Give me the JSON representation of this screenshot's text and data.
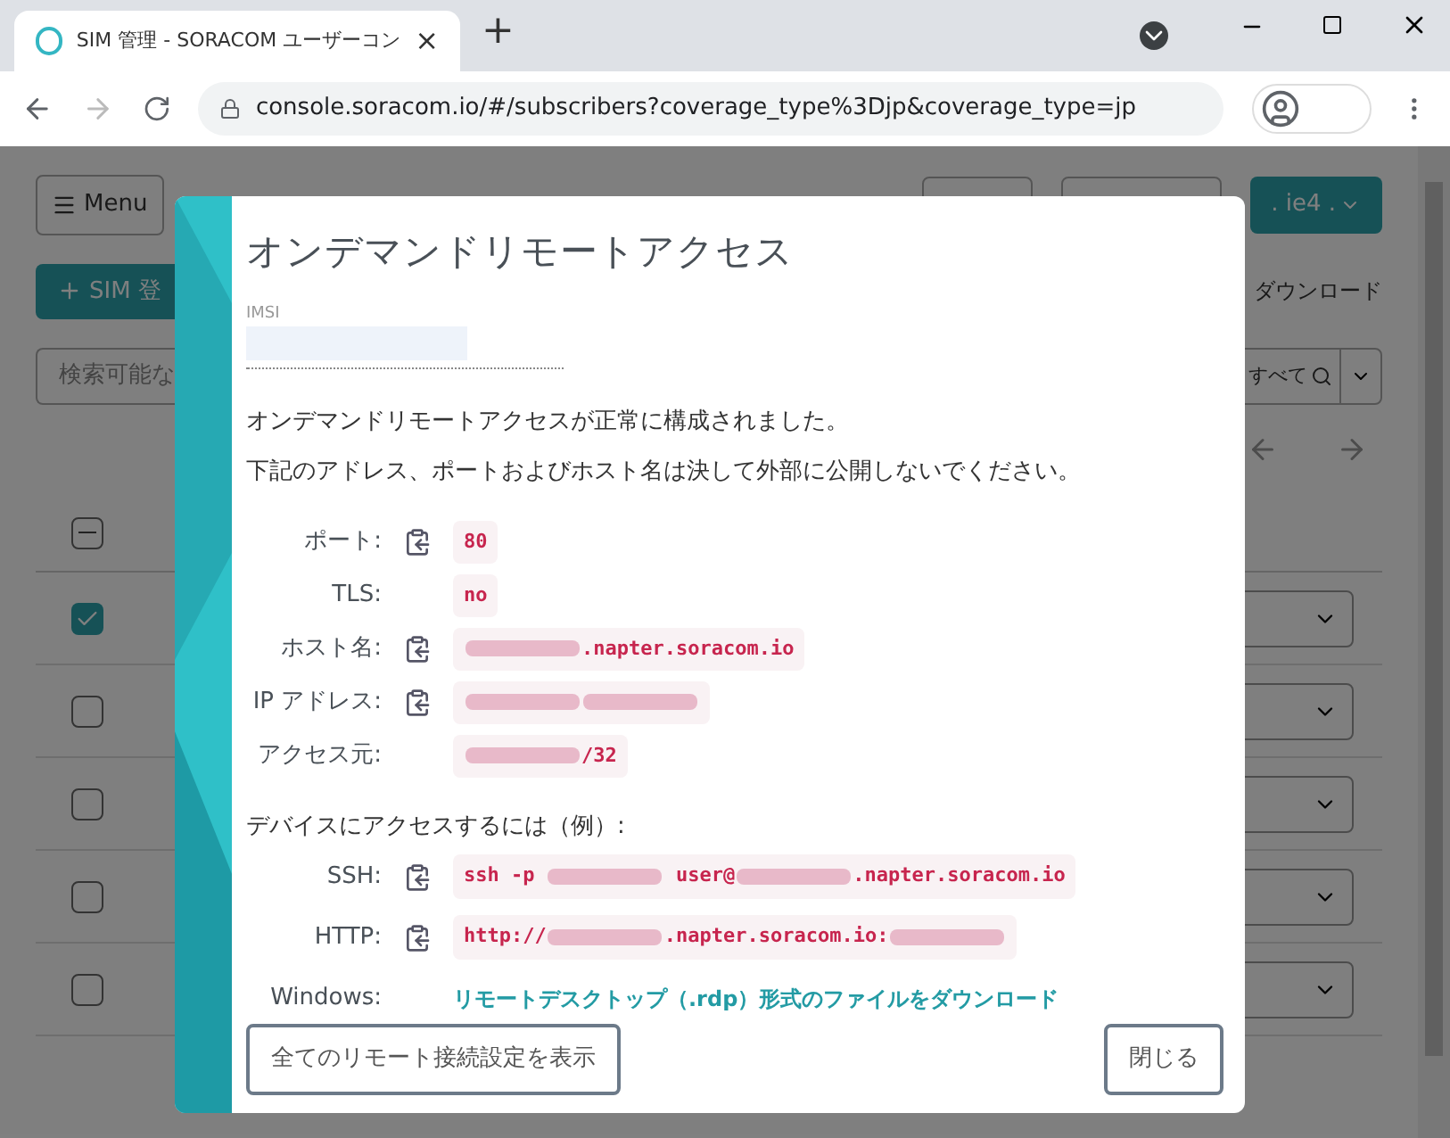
{
  "browser": {
    "tab": {
      "title": "SIM 管理 - SORACOM ユーザーコン",
      "close": "×"
    },
    "new_tab": "+",
    "url": "console.soracom.io/#/subscribers?coverage_type%3Djp&coverage_type=jp"
  },
  "page": {
    "menu_button": "Menu",
    "account_button": ". ie4 .",
    "add_sim_button": "SIM 登",
    "download_link": "ダウンロード",
    "search": {
      "placeholder": "検索可能な"
    },
    "search_scope": "すべて",
    "header_checkbox": {
      "indeterminate": true
    },
    "rows": [
      {
        "checked": true
      },
      {
        "checked": false
      },
      {
        "checked": false
      },
      {
        "checked": false
      },
      {
        "checked": false
      }
    ]
  },
  "modal": {
    "title": "オンデマンドリモートアクセス",
    "imsi": {
      "label": "IMSI"
    },
    "messages": [
      "オンデマンドリモートアクセスが正常に構成されました。",
      "下記のアドレス、ポートおよびホスト名は決して外部に公開しないでください。"
    ],
    "fields": [
      {
        "label": "ポート:",
        "copyable": true,
        "value": [
          {
            "kind": "text",
            "text": "80"
          }
        ]
      },
      {
        "label": "TLS:",
        "copyable": false,
        "value": [
          {
            "kind": "text",
            "text": "no"
          }
        ]
      },
      {
        "label": "ホスト名:",
        "copyable": true,
        "value": [
          {
            "kind": "redacted"
          },
          {
            "kind": "text",
            "text": ".napter.soracom.io"
          }
        ]
      },
      {
        "label": "IP アドレス:",
        "copyable": true,
        "value": [
          {
            "kind": "redacted"
          },
          {
            "kind": "redacted"
          }
        ]
      },
      {
        "label": "アクセス元:",
        "copyable": false,
        "value": [
          {
            "kind": "redacted"
          },
          {
            "kind": "text",
            "text": "/32"
          }
        ]
      }
    ],
    "examples_heading": "デバイスにアクセスするには（例）:",
    "examples": [
      {
        "kind": "code",
        "label": "SSH:",
        "copyable": true,
        "value": [
          {
            "kind": "text",
            "text": "ssh -p "
          },
          {
            "kind": "redacted"
          },
          {
            "kind": "text",
            "text": " user@"
          },
          {
            "kind": "redacted"
          },
          {
            "kind": "text",
            "text": ".napter.soracom.io"
          }
        ]
      },
      {
        "kind": "code",
        "label": "HTTP:",
        "copyable": true,
        "value": [
          {
            "kind": "text",
            "text": "http://"
          },
          {
            "kind": "redacted"
          },
          {
            "kind": "text",
            "text": ".napter.soracom.io:"
          },
          {
            "kind": "redacted"
          }
        ]
      },
      {
        "kind": "link",
        "label": "Windows:",
        "copyable": false,
        "link": "リモートデスクトップ（.rdp）形式のファイルをダウンロード"
      }
    ],
    "show_all_button": "全てのリモート接続設定を表示",
    "close_button": "閉じる"
  }
}
